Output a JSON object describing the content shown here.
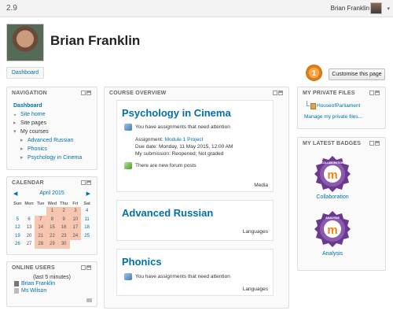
{
  "topbar": {
    "version": "2.9",
    "user_name": "Brian Franklin",
    "caret": "▾"
  },
  "header": {
    "name": "Brian Franklin",
    "dashboard_label": "Dashboard",
    "notification_count": "1",
    "customise_label": "Customise this page"
  },
  "navigation": {
    "title": "NAVIGATION",
    "dashboard": "Dashboard",
    "site_home": "Site home",
    "site_pages": "Site pages",
    "my_courses": "My courses",
    "courses": [
      "Advanced Russian",
      "Phonics",
      "Psychology in Cinema"
    ]
  },
  "calendar": {
    "title": "CALENDAR",
    "month": "April 2015",
    "prev": "◀",
    "next": "▶",
    "days": [
      "Sun",
      "Mon",
      "Tue",
      "Wed",
      "Thu",
      "Fri",
      "Sat"
    ],
    "weeks": [
      [
        "",
        "",
        "",
        "1",
        "2",
        "3",
        "4"
      ],
      [
        "5",
        "6",
        "7",
        "8",
        "9",
        "10",
        "11"
      ],
      [
        "12",
        "13",
        "14",
        "15",
        "16",
        "17",
        "18"
      ],
      [
        "19",
        "20",
        "21",
        "22",
        "23",
        "24",
        "25"
      ],
      [
        "26",
        "27",
        "28",
        "29",
        "30",
        "",
        ""
      ]
    ],
    "highlighted": [
      "1",
      "2",
      "3",
      "7",
      "8",
      "9",
      "10",
      "14",
      "15",
      "16",
      "17",
      "21",
      "22",
      "23",
      "24",
      "28",
      "29",
      "30"
    ]
  },
  "online_users": {
    "title": "ONLINE USERS",
    "subtitle": "(last 5 minutes)",
    "users": [
      "Brian Franklin",
      "Ms Wilson"
    ]
  },
  "course_overview": {
    "title": "COURSE OVERVIEW",
    "courses": [
      {
        "name": "Psychology in Cinema",
        "notice": "You have assignments that need attention",
        "assignment_label": "Assignment:",
        "assignment_link": "Module 1 Project",
        "due": "Due date: Monday, 11 May 2015, 12:00 AM",
        "submission": "My submission: Reopened; Not graded",
        "forum": "There are new forum posts",
        "category": "Media"
      },
      {
        "name": "Advanced Russian",
        "category": "Languages"
      },
      {
        "name": "Phonics",
        "notice": "You have assignments that need attention",
        "category": "Languages"
      }
    ]
  },
  "private_files": {
    "title": "MY PRIVATE FILES",
    "file": "HouseofParliament",
    "manage": "Manage my private files..."
  },
  "badges": {
    "title": "MY LATEST BADGES",
    "items": [
      {
        "name": "Collaboration",
        "ring_text": "COLLABORATION"
      },
      {
        "name": "Analysis",
        "ring_text": "ANALYSIS"
      }
    ]
  }
}
